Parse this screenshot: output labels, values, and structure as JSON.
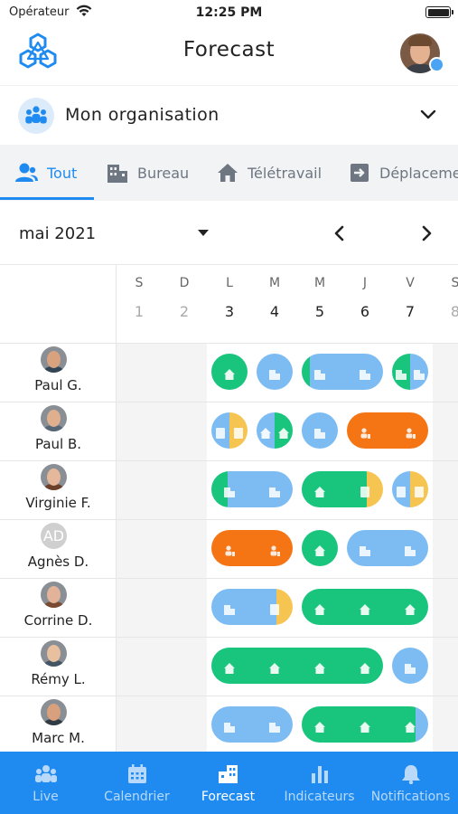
{
  "status_bar": {
    "carrier": "Opérateur",
    "time": "12:25 PM"
  },
  "header": {
    "title": "Forecast"
  },
  "org_selector": {
    "label": "Mon organisation"
  },
  "tabs": [
    {
      "label": "Tout",
      "icon": "people-icon",
      "active": true
    },
    {
      "label": "Bureau",
      "icon": "building-icon",
      "active": false
    },
    {
      "label": "Télétravail",
      "icon": "home-icon",
      "active": false
    },
    {
      "label": "Déplacement",
      "icon": "trip-icon",
      "active": false
    }
  ],
  "calendar": {
    "month": "mai 2021",
    "days": [
      {
        "letter": "S",
        "num": "1",
        "weekend": true
      },
      {
        "letter": "D",
        "num": "2",
        "weekend": true
      },
      {
        "letter": "L",
        "num": "3",
        "weekend": false
      },
      {
        "letter": "M",
        "num": "4",
        "weekend": false
      },
      {
        "letter": "M",
        "num": "5",
        "weekend": false
      },
      {
        "letter": "J",
        "num": "6",
        "weekend": false
      },
      {
        "letter": "V",
        "num": "7",
        "weekend": false
      },
      {
        "letter": "S",
        "num": "8",
        "weekend": true
      }
    ]
  },
  "colors": {
    "office": "#7cbcf3",
    "remote": "#19c47d",
    "travel": "#f57515",
    "other": "#f6c451",
    "accent": "#1f8bf0"
  },
  "people": [
    {
      "name": "Paul G.",
      "skin": "#d9a27e",
      "shirt": "#334455",
      "pills": [
        {
          "start": 2,
          "end": 2,
          "segs": [
            [
              "remote",
              1
            ]
          ]
        },
        {
          "start": 3,
          "end": 3,
          "segs": [
            [
              "office",
              1
            ]
          ]
        },
        {
          "start": 4,
          "end": 5,
          "segs": [
            [
              "remote",
              0.1
            ],
            [
              "office",
              0.9
            ]
          ]
        },
        {
          "start": 6,
          "end": 6,
          "segs": [
            [
              "remote",
              0.5
            ],
            [
              "office",
              0.5
            ]
          ]
        }
      ]
    },
    {
      "name": "Paul B.",
      "skin": "#e0b08e",
      "shirt": "#556677",
      "pills": [
        {
          "start": 2,
          "end": 2,
          "segs": [
            [
              "office",
              0.5
            ],
            [
              "other",
              0.5
            ]
          ]
        },
        {
          "start": 3,
          "end": 3,
          "segs": [
            [
              "office",
              0.5
            ],
            [
              "remote",
              0.5
            ]
          ]
        },
        {
          "start": 4,
          "end": 4,
          "segs": [
            [
              "office",
              1
            ]
          ]
        },
        {
          "start": 5,
          "end": 6,
          "segs": [
            [
              "travel",
              1
            ]
          ]
        }
      ]
    },
    {
      "name": "Virginie F.",
      "skin": "#e6b89b",
      "shirt": "#6b3f2a",
      "pills": [
        {
          "start": 2,
          "end": 3,
          "segs": [
            [
              "remote",
              0.2
            ],
            [
              "office",
              0.8
            ]
          ]
        },
        {
          "start": 4,
          "end": 5,
          "segs": [
            [
              "remote",
              0.8
            ],
            [
              "other",
              0.2
            ]
          ]
        },
        {
          "start": 6,
          "end": 6,
          "segs": [
            [
              "office",
              0.5
            ],
            [
              "other",
              0.5
            ]
          ]
        }
      ]
    },
    {
      "name": "Agnès D.",
      "initials": "AD",
      "pills": [
        {
          "start": 2,
          "end": 3,
          "segs": [
            [
              "travel",
              1
            ]
          ]
        },
        {
          "start": 4,
          "end": 4,
          "segs": [
            [
              "remote",
              1
            ]
          ]
        },
        {
          "start": 5,
          "end": 6,
          "segs": [
            [
              "office",
              1
            ]
          ]
        }
      ]
    },
    {
      "name": "Corrine D.",
      "skin": "#e2b398",
      "shirt": "#7a4a32",
      "pills": [
        {
          "start": 2,
          "end": 3,
          "segs": [
            [
              "office",
              0.8
            ],
            [
              "other",
              0.2
            ]
          ]
        },
        {
          "start": 4,
          "end": 6,
          "segs": [
            [
              "remote",
              1
            ]
          ]
        }
      ]
    },
    {
      "name": "Rémy L.",
      "skin": "#e8c09f",
      "shirt": "#445566",
      "pills": [
        {
          "start": 2,
          "end": 5,
          "segs": [
            [
              "remote",
              1
            ]
          ]
        },
        {
          "start": 6,
          "end": 6,
          "segs": [
            [
              "office",
              1
            ]
          ]
        }
      ]
    },
    {
      "name": "Marc M.",
      "skin": "#d8a07c",
      "shirt": "#2f3a44",
      "pills": [
        {
          "start": 2,
          "end": 3,
          "segs": [
            [
              "office",
              1
            ]
          ]
        },
        {
          "start": 4,
          "end": 6,
          "segs": [
            [
              "remote",
              0.9
            ],
            [
              "office",
              0.1
            ]
          ]
        }
      ]
    }
  ],
  "bottom_nav": [
    {
      "label": "Live",
      "icon": "people-icon",
      "active": false
    },
    {
      "label": "Calendrier",
      "icon": "calendar-icon",
      "active": false
    },
    {
      "label": "Forecast",
      "icon": "forecast-building-icon",
      "active": true
    },
    {
      "label": "Indicateurs",
      "icon": "bar-chart-icon",
      "active": false
    },
    {
      "label": "Notifications",
      "icon": "bell-icon",
      "active": false
    }
  ]
}
